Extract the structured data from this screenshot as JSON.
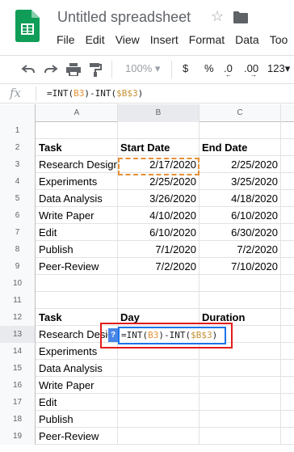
{
  "app": {
    "title": "Untitled spreadsheet",
    "menu": [
      "File",
      "Edit",
      "View",
      "Insert",
      "Format",
      "Data",
      "Too"
    ],
    "icons": [
      "sheets-logo-icon",
      "star-icon",
      "folder-icon"
    ]
  },
  "toolbar": {
    "zoom": "100%",
    "currency": "$",
    "percent": "%",
    "decimal_less": ".0",
    "decimal_more": ".00",
    "more_formats": "123"
  },
  "formula_bar": {
    "fx_label": "fx",
    "prefix": "=INT(",
    "ref1": "B3",
    "mid": ")-INT(",
    "ref2": "$B$3",
    "suffix": ")"
  },
  "columns": [
    "A",
    "B",
    "C"
  ],
  "rows": [
    {
      "n": "1",
      "a": "",
      "b": "",
      "c": ""
    },
    {
      "n": "2",
      "a": "Task",
      "b": "Start Date",
      "c": "End Date",
      "bold": true
    },
    {
      "n": "3",
      "a": "Research Design",
      "b": "2/17/2020",
      "c": "2/25/2020"
    },
    {
      "n": "4",
      "a": "Experiments",
      "b": "2/25/2020",
      "c": "3/25/2020"
    },
    {
      "n": "5",
      "a": "Data Analysis",
      "b": "3/26/2020",
      "c": "4/18/2020"
    },
    {
      "n": "6",
      "a": "Write Paper",
      "b": "4/10/2020",
      "c": "6/10/2020"
    },
    {
      "n": "7",
      "a": "Edit",
      "b": "6/10/2020",
      "c": "6/30/2020"
    },
    {
      "n": "8",
      "a": "Publish",
      "b": "7/1/2020",
      "c": "7/2/2020"
    },
    {
      "n": "9",
      "a": "Peer-Review",
      "b": "7/2/2020",
      "c": "7/10/2020"
    },
    {
      "n": "10",
      "a": "",
      "b": "",
      "c": ""
    },
    {
      "n": "11",
      "a": "",
      "b": "",
      "c": ""
    },
    {
      "n": "12",
      "a": "Task",
      "b": "Day",
      "c": "Duration",
      "bold": true
    },
    {
      "n": "13",
      "a": "Research Design",
      "b": "",
      "c": ""
    },
    {
      "n": "14",
      "a": "Experiments",
      "b": "",
      "c": ""
    },
    {
      "n": "15",
      "a": "Data Analysis",
      "b": "",
      "c": ""
    },
    {
      "n": "16",
      "a": "Write Paper",
      "b": "",
      "c": ""
    },
    {
      "n": "17",
      "a": "Edit",
      "b": "",
      "c": ""
    },
    {
      "n": "18",
      "a": "Publish",
      "b": "",
      "c": ""
    },
    {
      "n": "19",
      "a": "Peer-Review",
      "b": "",
      "c": ""
    }
  ],
  "active_cell_badge": "?",
  "colors": {
    "ref_highlight": "#e69138",
    "edit_border": "#1a73e8",
    "annotation": "#e21b1b",
    "sheets_green": "#0f9d58"
  }
}
